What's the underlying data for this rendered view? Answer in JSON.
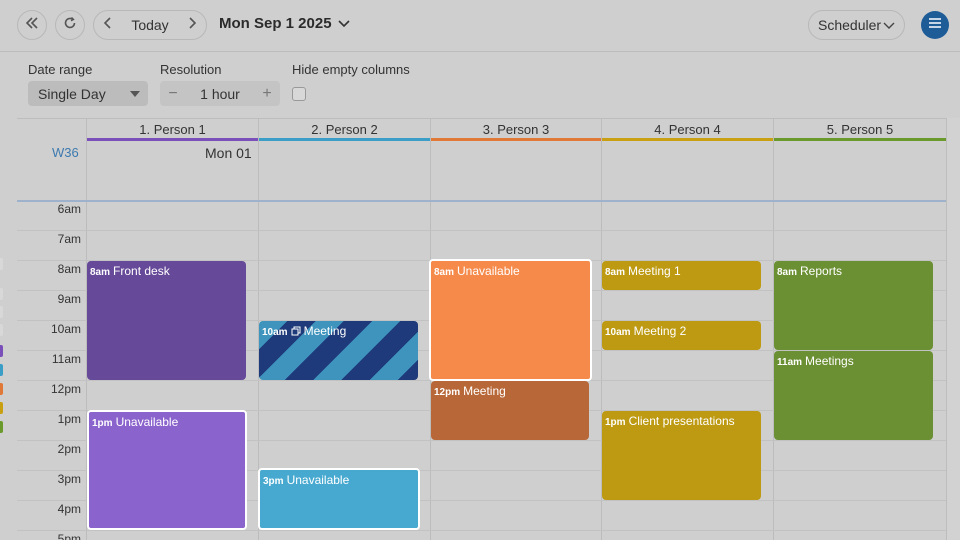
{
  "toolbar": {
    "today_label": "Today",
    "date_title": "Mon Sep 1 2025",
    "view_label": "Scheduler"
  },
  "options": {
    "date_range_label": "Date range",
    "date_range_value": "Single Day",
    "resolution_label": "Resolution",
    "resolution_value": "1 hour",
    "minus": "−",
    "plus": "+",
    "hide_empty_label": "Hide empty columns"
  },
  "header": {
    "week": "W36",
    "day": "Mon 01"
  },
  "columns": [
    {
      "label": "1. Person 1",
      "color": "#7b4fb9"
    },
    {
      "label": "2. Person 2",
      "color": "#3b9ec7"
    },
    {
      "label": "3. Person 3",
      "color": "#e07838"
    },
    {
      "label": "4. Person 4",
      "color": "#c9a012"
    },
    {
      "label": "5. Person 5",
      "color": "#6a9a2c"
    }
  ],
  "times": [
    "6am",
    "7am",
    "8am",
    "9am",
    "10am",
    "11am",
    "12pm",
    "1pm",
    "2pm",
    "3pm",
    "4pm",
    "5pm"
  ],
  "events": {
    "e1": {
      "time": "8am",
      "title": "Front desk",
      "color": "#664a99"
    },
    "e2": {
      "time": "1pm",
      "title": "Unavailable",
      "color": "#8a63cc"
    },
    "e3": {
      "time": "10am",
      "title": "Meeting",
      "color": "#1e3a7a"
    },
    "e4": {
      "time": "3pm",
      "title": "Unavailable",
      "color": "#47a9d0"
    },
    "e5": {
      "time": "8am",
      "title": "Unavailable",
      "color": "#f58a4b"
    },
    "e6": {
      "time": "12pm",
      "title": "Meeting",
      "color": "#b86838"
    },
    "e7": {
      "time": "8am",
      "title": "Meeting 1",
      "color": "#bd9a12"
    },
    "e8": {
      "time": "10am",
      "title": "Meeting 2",
      "color": "#bd9a12"
    },
    "e9": {
      "time": "1pm",
      "title": "Client presentations",
      "color": "#bd9a12"
    },
    "e10": {
      "time": "8am",
      "title": "Reports",
      "color": "#6b8f33"
    },
    "e11": {
      "time": "11am",
      "title": "Meetings",
      "color": "#6b8f33"
    }
  }
}
